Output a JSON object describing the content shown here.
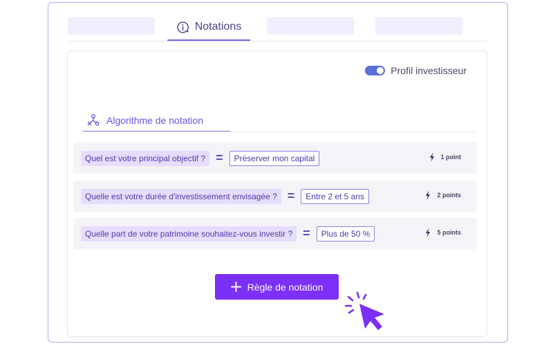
{
  "tabs": {
    "active_label": "Notations"
  },
  "card": {
    "profile_toggle": {
      "label": "Profil investisseur",
      "enabled": true
    },
    "section_tab": {
      "label": "Algorithme de notation"
    },
    "rules": [
      {
        "question": "Quel est votre principal objectif ?",
        "operator": "=",
        "answer": "Préserver mon capital",
        "points": "1 point"
      },
      {
        "question": "Quelle est votre durée d'investissement envisagée ?",
        "operator": "=",
        "answer": "Entre 2 et 5 ans",
        "points": "2 points"
      },
      {
        "question": "Quelle part de votre patrimoine souhaitez-vous investir ?",
        "operator": "=",
        "answer": "Plus de 50 %",
        "points": "5 points"
      }
    ],
    "add_button": {
      "label": "Règle de notation",
      "icon": "plus-icon"
    }
  },
  "colors": {
    "accent": "#7b2ff7",
    "tab_underline": "#7b5ee8",
    "question_bg": "#e6ddfc",
    "toggle": "#5b6fd6"
  }
}
